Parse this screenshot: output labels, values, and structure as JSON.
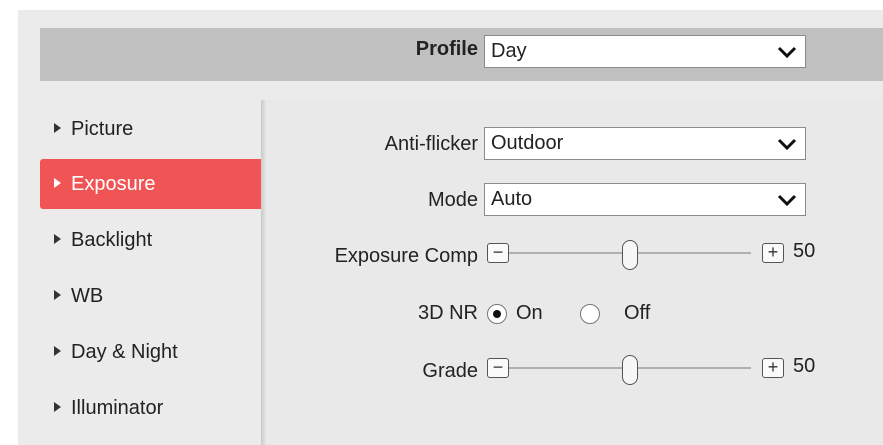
{
  "profile": {
    "label": "Profile",
    "value": "Day"
  },
  "sidebar": {
    "items": [
      {
        "label": "Picture"
      },
      {
        "label": "Exposure"
      },
      {
        "label": "Backlight"
      },
      {
        "label": "WB"
      },
      {
        "label": "Day & Night"
      },
      {
        "label": "Illuminator"
      }
    ],
    "active_index": 1
  },
  "form": {
    "anti_flicker": {
      "label": "Anti-flicker",
      "value": "Outdoor"
    },
    "mode": {
      "label": "Mode",
      "value": "Auto"
    },
    "exposure_comp": {
      "label": "Exposure Comp",
      "value": "50",
      "level": 50,
      "max": 100
    },
    "nr3d": {
      "label": "3D NR",
      "on_label": "On",
      "off_label": "Off",
      "selected": "On"
    },
    "grade": {
      "label": "Grade",
      "value": "50",
      "level": 50,
      "max": 100
    }
  },
  "colors": {
    "active": "#f05455",
    "profile_bar": "#c0c0c0"
  }
}
